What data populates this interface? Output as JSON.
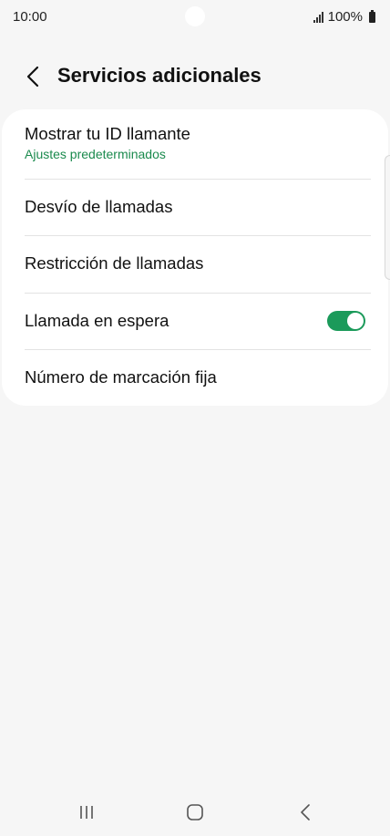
{
  "status_bar": {
    "time": "10:00",
    "battery": "100%"
  },
  "header": {
    "title": "Servicios adicionales",
    "back_icon": "back-arrow-icon"
  },
  "settings": {
    "items": [
      {
        "title": "Mostrar tu ID llamante",
        "subtitle": "Ajustes predeterminados"
      },
      {
        "title": "Desvío de llamadas"
      },
      {
        "title": "Restricción de llamadas"
      },
      {
        "title": "Llamada en espera",
        "toggle": true
      },
      {
        "title": "Número de marcación fija"
      }
    ]
  },
  "colors": {
    "accent": "#1b9a5a",
    "subtitle": "#1a8a4d",
    "background": "#f6f6f6",
    "card": "#ffffff"
  },
  "nav": {
    "icons": [
      "recents-icon",
      "home-icon",
      "back-icon"
    ]
  }
}
